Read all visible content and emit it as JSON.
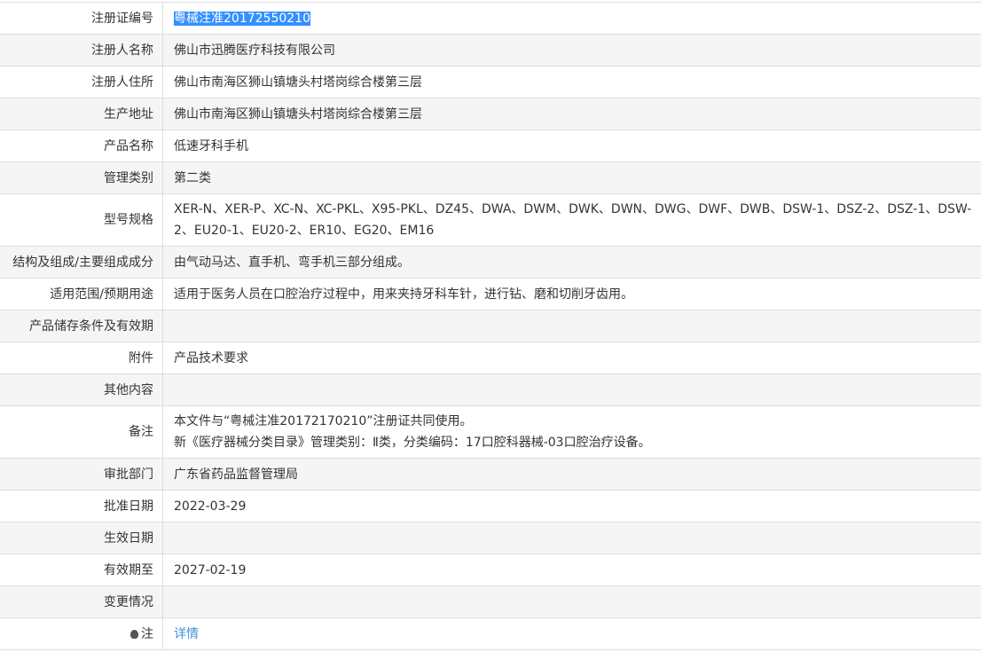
{
  "rows": [
    {
      "label": "注册证编号",
      "value": "粤械注准20172550210"
    },
    {
      "label": "注册人名称",
      "value": "佛山市迅腾医疗科技有限公司"
    },
    {
      "label": "注册人住所",
      "value": "佛山市南海区狮山镇塘头村塔岗综合楼第三层"
    },
    {
      "label": "生产地址",
      "value": "佛山市南海区狮山镇塘头村塔岗综合楼第三层"
    },
    {
      "label": "产品名称",
      "value": "低速牙科手机"
    },
    {
      "label": "管理类别",
      "value": "第二类"
    },
    {
      "label": "型号规格",
      "value": "XER-N、XER-P、XC-N、XC-PKL、X95-PKL、DZ45、DWA、DWM、DWK、DWN、DWG、DWF、DWB、DSW-1、DSZ-2、DSZ-1、DSW-2、EU20-1、EU20-2、ER10、EG20、EM16"
    },
    {
      "label": "结构及组成/主要组成成分",
      "value": "由气动马达、直手机、弯手机三部分组成。"
    },
    {
      "label": "适用范围/预期用途",
      "value": "适用于医务人员在口腔治疗过程中，用来夹持牙科车针，进行钻、磨和切削牙齿用。"
    },
    {
      "label": "产品储存条件及有效期",
      "value": ""
    },
    {
      "label": "附件",
      "value": "产品技术要求"
    },
    {
      "label": "其他内容",
      "value": ""
    },
    {
      "label": "备注",
      "value_line1": "本文件与“粤械注准20172170210”注册证共同使用。",
      "value_line2": "新《医疗器械分类目录》管理类别：Ⅱ类，分类编码：17口腔科器械-03口腔治疗设备。"
    },
    {
      "label": "审批部门",
      "value": "广东省药品监督管理局"
    },
    {
      "label": "批准日期",
      "value": "2022-03-29"
    },
    {
      "label": "生效日期",
      "value": ""
    },
    {
      "label": "有效期至",
      "value": "2027-02-19"
    },
    {
      "label": "变更情况",
      "value": ""
    },
    {
      "label": "注",
      "value": "详情",
      "icon": "lightbulb-icon"
    }
  ]
}
